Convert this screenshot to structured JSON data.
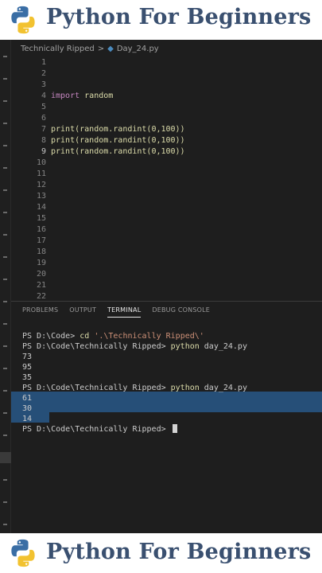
{
  "banner": {
    "title": "Python For Beginners"
  },
  "breadcrumb": {
    "folder": "Technically Ripped",
    "separator": ">",
    "file": "Day_24.py"
  },
  "editor": {
    "line_numbers": [
      "1",
      "2",
      "3",
      "4",
      "5",
      "6",
      "7",
      "8",
      "9",
      "10",
      "11",
      "12",
      "13",
      "14",
      "15",
      "16",
      "17",
      "18",
      "19",
      "20",
      "21",
      "22"
    ],
    "current_line": "9",
    "code": {
      "import_kw": "import",
      "import_mod": "random",
      "print_fn": "print",
      "call_text": "(random.randint(0,100))"
    }
  },
  "panel": {
    "tabs": [
      "PROBLEMS",
      "OUTPUT",
      "TERMINAL",
      "DEBUG CONSOLE"
    ],
    "active_tab": "TERMINAL",
    "terminal": {
      "p1_prompt": "PS D:\\Code> ",
      "p1_cmd": "cd",
      "p1_arg": "'.\\Technically Ripped\\'",
      "p2_prompt": "PS D:\\Code\\Technically Ripped> ",
      "p2_cmd": "python",
      "p2_arg": " day_24.py",
      "out1": [
        "73",
        "95",
        "35"
      ],
      "p3_prompt": "PS D:\\Code\\Technically Ripped> ",
      "p3_cmd": "python",
      "p3_arg": " day_24.py",
      "out2": [
        "61",
        "30",
        "14"
      ],
      "p4_prompt": "PS D:\\Code\\Technically Ripped> "
    }
  },
  "colors": {
    "editor_bg": "#1e1e1e",
    "selection": "#264f78",
    "banner_text": "#3a5070"
  },
  "icons": {
    "logo": "python-logo-icon",
    "file": "python-file-icon",
    "cursor": "terminal-cursor-icon"
  }
}
